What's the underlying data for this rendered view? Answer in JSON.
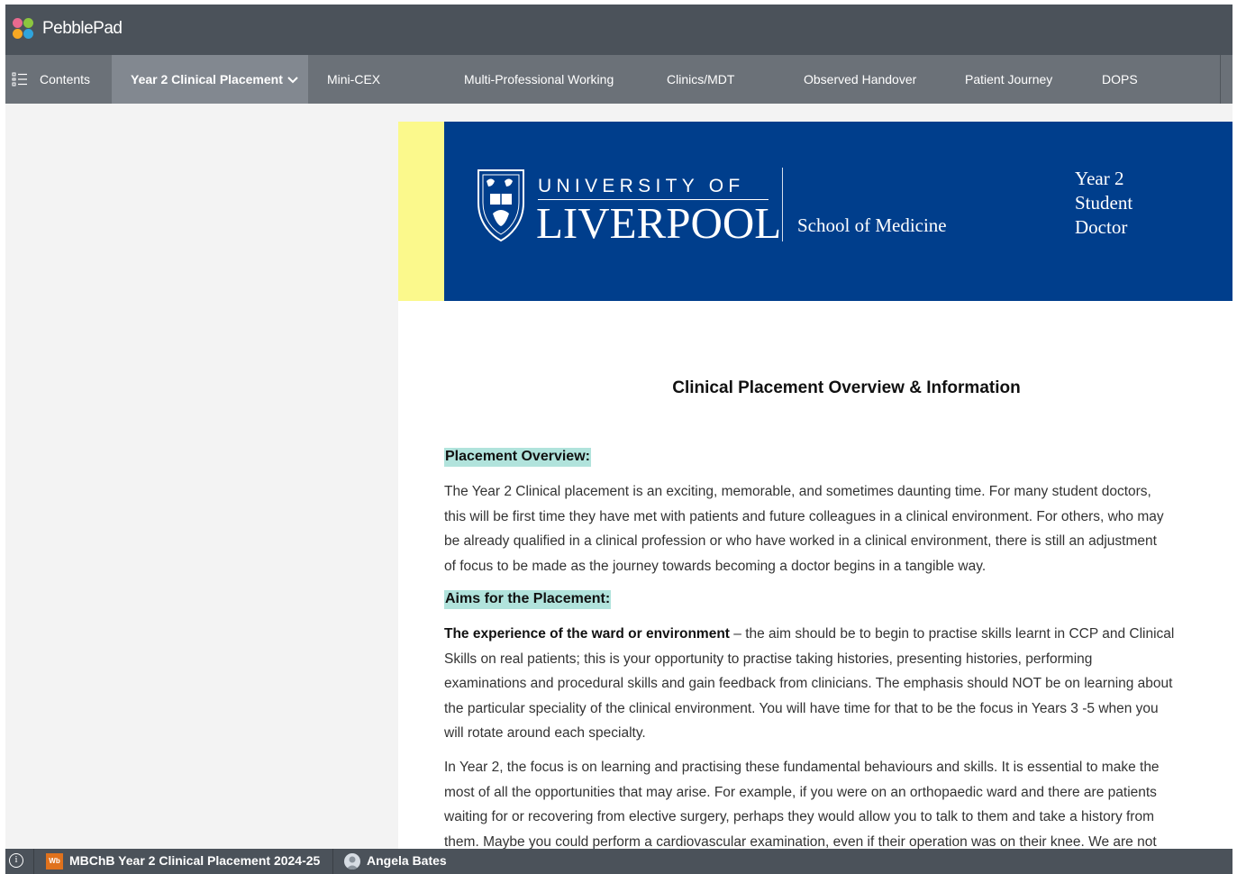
{
  "app": {
    "name": "PebblePad"
  },
  "tabs": [
    {
      "label": "Contents",
      "icon": "contents-list-icon"
    },
    {
      "label": "Year 2 Clinical Placement",
      "active": true,
      "icon": "chevron-down-icon"
    },
    {
      "label": "Mini-CEX"
    },
    {
      "label": "Multi-Professional Working"
    },
    {
      "label": "Clinics/MDT"
    },
    {
      "label": "Observed Handover"
    },
    {
      "label": "Patient Journey"
    },
    {
      "label": "DOPS"
    }
  ],
  "banner": {
    "university_top": "UNIVERSITY OF",
    "university_name": "LIVERPOOL",
    "school": "School of Medicine",
    "role_lines": [
      "Year 2",
      "Student",
      "Doctor"
    ],
    "colors": {
      "banner": "#003e8c",
      "yellow_strip": "#fbf98c"
    }
  },
  "content": {
    "title": "Clinical Placement Overview & Information",
    "overview_heading": "Placement Overview:",
    "overview_lines": [
      "The Year 2 Clinical placement is an exciting, memorable, and sometimes daunting time. For many student doctors,",
      "this will be first time they have met with patients and future colleagues in a clinical environment. For others, who may",
      "be already qualified in a clinical profession or who have worked in a clinical environment, there is still an adjustment",
      "of focus to be made as the journey towards becoming a doctor begins in a tangible way."
    ],
    "aims_heading": "Aims for the Placement:",
    "aims_bold": "The experience of the ward or environment",
    "aims_lines": [
      " – the aim should be to begin to practise skills learnt in CCP and Clinical",
      "Skills on real patients; this is your opportunity to practise taking histories, presenting histories, performing",
      "examinations and procedural skills and gain feedback from clinicians. The emphasis should NOT be on learning about",
      "the particular speciality of the clinical environment. You will have time for that to be the focus in Years 3 -5 when you",
      "will rotate around each specialty."
    ],
    "year2_lines": [
      "In Year 2, the focus is on learning and practising these fundamental behaviours and skills. It is essential to make the",
      "most of all the opportunities that may arise. For example, if you were on an orthopaedic ward and there are patients",
      "waiting for or recovering from elective surgery, perhaps they would allow you to talk to them and take a history from",
      "them. Maybe you could perform a cardiovascular examination, even if their operation was on their knee. We are not"
    ]
  },
  "statusbar": {
    "workbook_badge": "Wb",
    "workbook_title": "MBChB Year 2 Clinical Placement 2024-25",
    "user_name": "Angela Bates"
  }
}
